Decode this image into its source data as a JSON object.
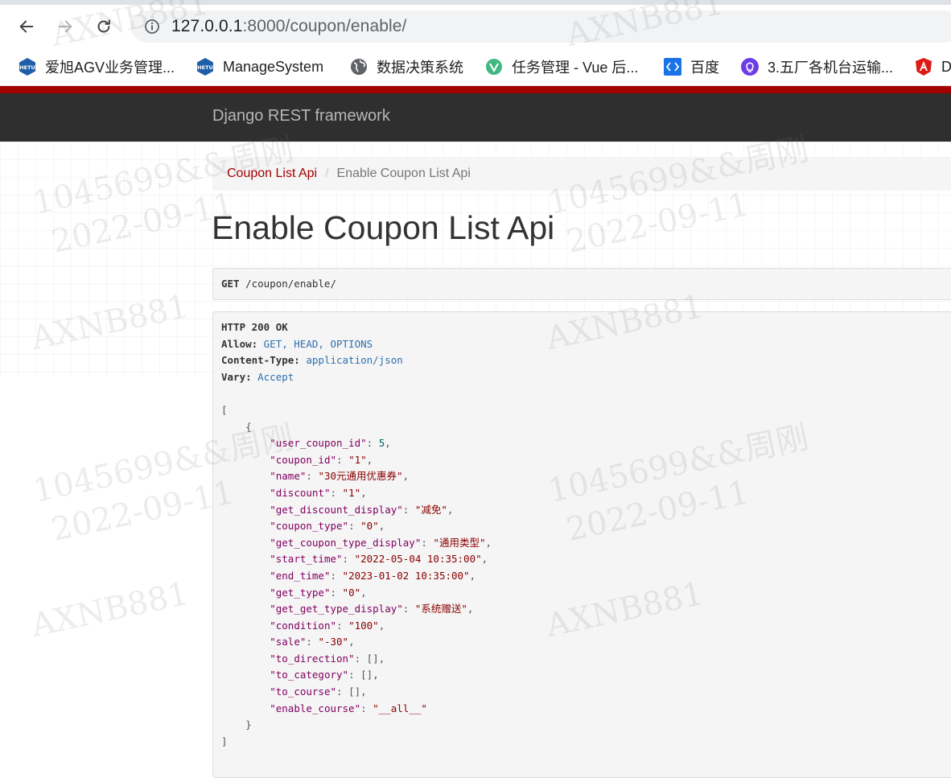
{
  "browser": {
    "url_host": "127.0.0.1",
    "url_rest": ":8000/coupon/enable/",
    "bookmarks": [
      {
        "label": "爱旭AGV业务管理...",
        "icon": "hetu-hexagon-icon"
      },
      {
        "label": "ManageSystem",
        "icon": "hetu-hexagon-icon"
      },
      {
        "label": "数据决策系统",
        "icon": "globe-icon"
      },
      {
        "label": "任务管理 - Vue 后...",
        "icon": "vue-icon"
      },
      {
        "label": "百度",
        "icon": "code-brackets-icon"
      },
      {
        "label": "3.五厂各机台运输...",
        "icon": "lightbulb-icon"
      },
      {
        "label": "D",
        "icon": "angular-icon"
      }
    ]
  },
  "drf": {
    "brand": "Django REST framework",
    "breadcrumb": {
      "link": "Coupon List Api",
      "sep": "/",
      "active": "Enable Coupon List Api"
    },
    "title": "Enable Coupon List Api",
    "request": {
      "method": "GET",
      "path": " /coupon/enable/"
    },
    "response_headers": {
      "status": "HTTP 200 OK",
      "allow_key": "Allow:",
      "allow_val": " GET, HEAD, OPTIONS",
      "ctype_key": "Content-Type:",
      "ctype_val": " application/json",
      "vary_key": "Vary:",
      "vary_val": " Accept"
    },
    "json_fields": [
      {
        "key": "\"user_coupon_id\"",
        "val": "5",
        "type": "num"
      },
      {
        "key": "\"coupon_id\"",
        "val": "\"1\"",
        "type": "str"
      },
      {
        "key": "\"name\"",
        "val": "\"30元通用优惠券\"",
        "type": "str"
      },
      {
        "key": "\"discount\"",
        "val": "\"1\"",
        "type": "str"
      },
      {
        "key": "\"get_discount_display\"",
        "val": "\"减免\"",
        "type": "str"
      },
      {
        "key": "\"coupon_type\"",
        "val": "\"0\"",
        "type": "str"
      },
      {
        "key": "\"get_coupon_type_display\"",
        "val": "\"通用类型\"",
        "type": "str"
      },
      {
        "key": "\"start_time\"",
        "val": "\"2022-05-04 10:35:00\"",
        "type": "str"
      },
      {
        "key": "\"end_time\"",
        "val": "\"2023-01-02 10:35:00\"",
        "type": "str"
      },
      {
        "key": "\"get_type\"",
        "val": "\"0\"",
        "type": "str"
      },
      {
        "key": "\"get_get_type_display\"",
        "val": "\"系统赠送\"",
        "type": "str"
      },
      {
        "key": "\"condition\"",
        "val": "\"100\"",
        "type": "str"
      },
      {
        "key": "\"sale\"",
        "val": "\"-30\"",
        "type": "str"
      },
      {
        "key": "\"to_direction\"",
        "val": "[]",
        "type": "pun"
      },
      {
        "key": "\"to_category\"",
        "val": "[]",
        "type": "pun"
      },
      {
        "key": "\"to_course\"",
        "val": "[]",
        "type": "pun"
      },
      {
        "key": "\"enable_course\"",
        "val": "\"__all__\"",
        "type": "str"
      }
    ]
  },
  "watermark": {
    "tag": "AXNB881",
    "id": "1045699&&周刚",
    "date": "2022-09-11"
  },
  "colors": {
    "drf_red": "#a30000",
    "navbar": "#2f2f2f",
    "json_key": "#800060",
    "json_string": "#880000",
    "json_number": "#006666",
    "header_value": "#2c6fae"
  }
}
